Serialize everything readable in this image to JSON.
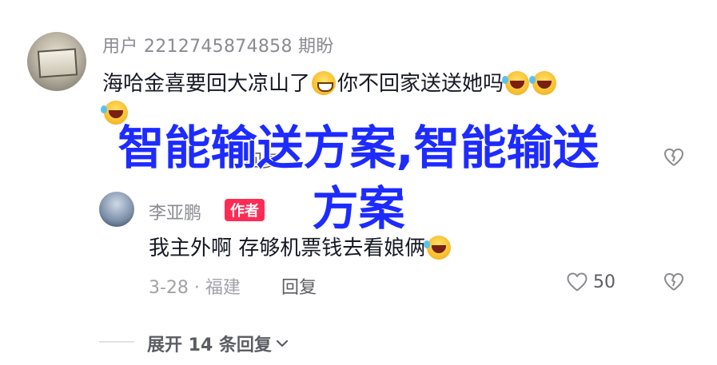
{
  "comment": {
    "username": "用户 2212745874858 期盼",
    "text_part1": "海哈金喜要回大凉山了",
    "text_part2": "你不回家送送她吗",
    "emoji_grin": "grinning-face-emoji",
    "emoji_laugh": "tears-of-joy-emoji",
    "reply_label": "回复"
  },
  "overlay": {
    "line1": "智能输送方案,智能输送",
    "line2": "方案",
    "color": "#1d2bff"
  },
  "reply": {
    "username": "李亚鹏",
    "badge": "作者",
    "text": "我主外啊 存够机票钱去看娘俩",
    "meta": "3-28 · 福建",
    "reply_label": "回复",
    "likes": "50"
  },
  "expand": {
    "label": "展开 14 条回复"
  },
  "colors": {
    "accent": "#fe2c55",
    "text": "#161823",
    "muted": "#8a8b91"
  }
}
